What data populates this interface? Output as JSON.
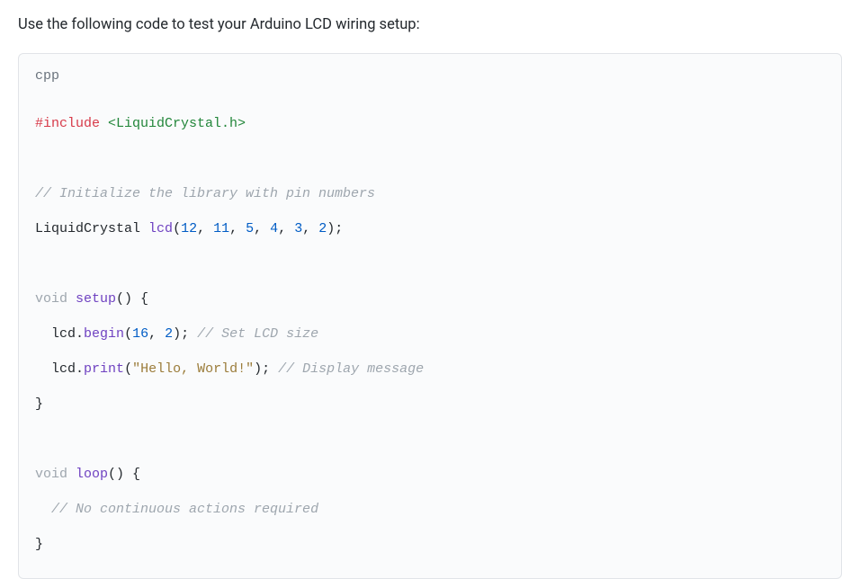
{
  "intro_text": "Use the following code to test your Arduino LCD wiring setup:",
  "code": {
    "language": "cpp",
    "tokens": {
      "include_directive": "#include",
      "include_header": "<LiquidCrystal.h>",
      "comment_init": "// Initialize the library with pin numbers",
      "lcd_type": "LiquidCrystal",
      "lcd_var": "lcd",
      "ctor_args": "12, 11, 5, 4, 3, 2",
      "ctor_arg_1": "12",
      "ctor_arg_2": "11",
      "ctor_arg_3": "5",
      "ctor_arg_4": "4",
      "ctor_arg_5": "3",
      "ctor_arg_6": "2",
      "void1": "void",
      "setup_fn": "setup",
      "begin_obj": "lcd",
      "begin_fn": "begin",
      "begin_arg1": "16",
      "begin_arg2": "2",
      "comment_size": "// Set LCD size",
      "print_obj": "lcd",
      "print_fn": "print",
      "print_str": "\"Hello, World!\"",
      "comment_display": "// Display message",
      "void2": "void",
      "loop_fn": "loop",
      "comment_loop": "// No continuous actions required"
    }
  }
}
